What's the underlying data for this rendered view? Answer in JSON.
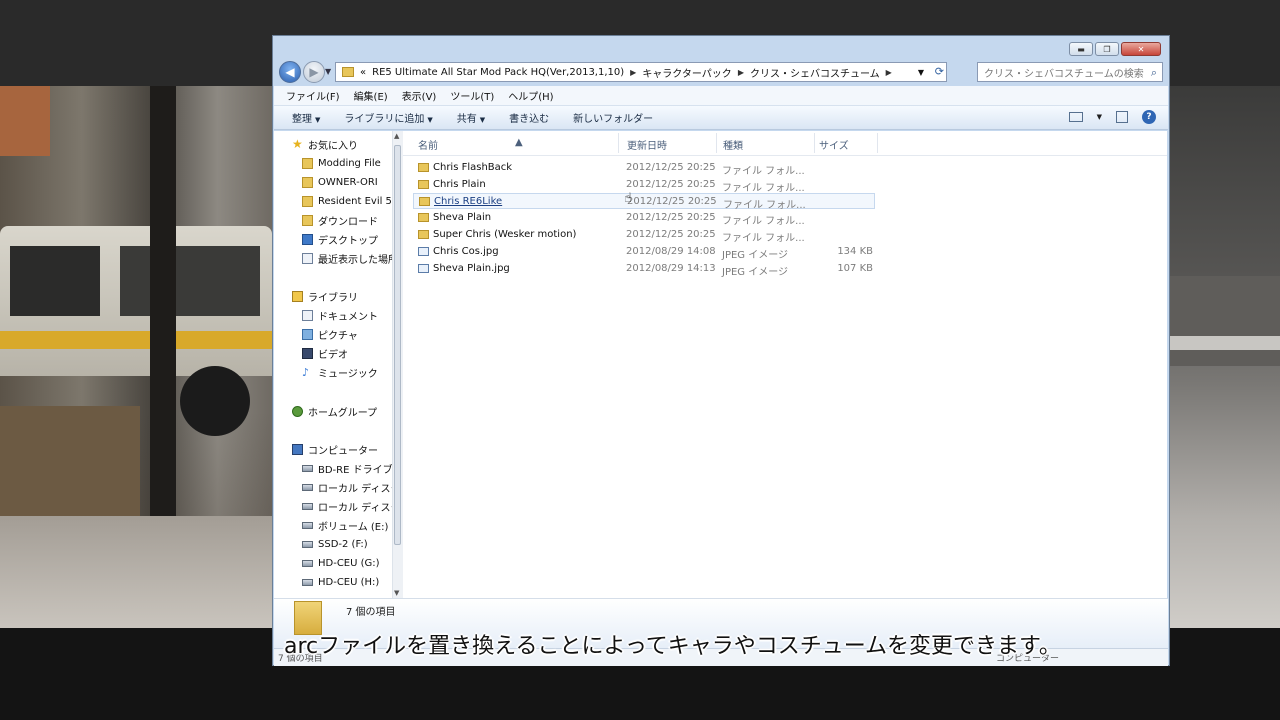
{
  "window": {
    "controls": {
      "minimize": "▬",
      "maximize": "❐",
      "close": "✕"
    }
  },
  "address": {
    "prefix": "«",
    "crumbs": [
      "RE5 Ultimate All Star Mod Pack HQ(Ver,2013,1,10)",
      "キャラクターパック",
      "クリス・シェバコスチューム"
    ],
    "search_placeholder": "クリス・シェバコスチュームの検索"
  },
  "menu": [
    "ファイル(F)",
    "編集(E)",
    "表示(V)",
    "ツール(T)",
    "ヘルプ(H)"
  ],
  "toolbar": {
    "organize": "整理",
    "add_to_library": "ライブラリに追加",
    "share": "共有",
    "burn": "書き込む",
    "new_folder": "新しいフォルダー"
  },
  "nav": {
    "favorites": "お気に入り",
    "favorites_items": [
      "Modding File",
      "OWNER-ORI",
      "Resident Evil 5",
      "ダウンロード",
      "デスクトップ",
      "最近表示した場所"
    ],
    "libraries": "ライブラリ",
    "libraries_items": [
      "ドキュメント",
      "ピクチャ",
      "ビデオ",
      "ミュージック"
    ],
    "homegroup": "ホームグループ",
    "computer": "コンピューター",
    "computer_items": [
      "BD-RE ドライブ",
      "ローカル ディスク",
      "ローカル ディスク",
      "ボリューム (E:)",
      "SSD-2 (F:)",
      "HD-CEU (G:)",
      "HD-CEU (H:)"
    ]
  },
  "columns": {
    "name": "名前",
    "date": "更新日時",
    "type": "種類",
    "size": "サイズ"
  },
  "files": [
    {
      "name": "Chris FlashBack",
      "date": "2012/12/25 20:25",
      "type": "ファイル フォル...",
      "size": "",
      "kind": "folder"
    },
    {
      "name": "Chris Plain",
      "date": "2012/12/25 20:25",
      "type": "ファイル フォル...",
      "size": "",
      "kind": "folder"
    },
    {
      "name": "Chris RE6Like",
      "date": "2012/12/25 20:25",
      "type": "ファイル フォル...",
      "size": "",
      "kind": "folder"
    },
    {
      "name": "Sheva Plain",
      "date": "2012/12/25 20:25",
      "type": "ファイル フォル...",
      "size": "",
      "kind": "folder"
    },
    {
      "name": "Super Chris (Wesker motion)",
      "date": "2012/12/25 20:25",
      "type": "ファイル フォル...",
      "size": "",
      "kind": "folder"
    },
    {
      "name": "Chris Cos.jpg",
      "date": "2012/08/29 14:08",
      "type": "JPEG イメージ",
      "size": "134 KB",
      "kind": "jpeg"
    },
    {
      "name": "Sheva Plain.jpg",
      "date": "2012/08/29 14:13",
      "type": "JPEG イメージ",
      "size": "107 KB",
      "kind": "jpeg"
    }
  ],
  "details": {
    "count": "7 個の項目"
  },
  "status": {
    "left": "7 個の項目",
    "right": "コンピューター"
  },
  "subtitle": "arcファイルを置き換えることによってキャラやコスチュームを変更できます。"
}
